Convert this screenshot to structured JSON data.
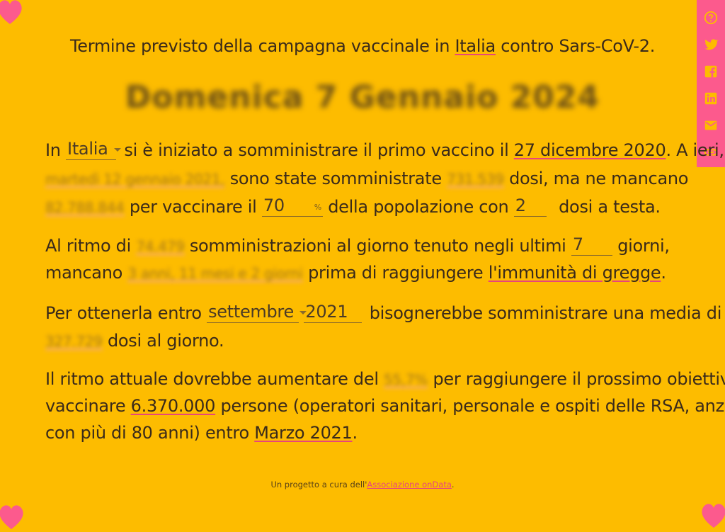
{
  "header": {
    "prefix": "Termine previsto della campagna vaccinale in",
    "country_link": "Italia",
    "suffix": "contro Sars-CoV-2.",
    "end_date": "Domenica 7 Gennaio 2024"
  },
  "para1": {
    "t1": "In",
    "country_select": "Italia",
    "t2": "si è iniziato a somministrare il primo vaccino il",
    "start_date": "27 dicembre 2020",
    "t3": ". A ieri,",
    "yesterday": "martedì 12 gennaio 2021,",
    "t4": "sono state somministrate",
    "doses_given": "731.539",
    "t5": "dosi, ma ne mancano",
    "doses_missing": "82.788.844",
    "t6": "per vaccinare il",
    "population_percent": "70",
    "percent_sign": "%",
    "t7": "della popolazione con",
    "doses_per_person": "2",
    "t8": "dosi a testa."
  },
  "para2": {
    "t1": "Al ritmo di",
    "rate": "74.479",
    "t2": "somministrazioni al giorno tenuto negli ultimi",
    "days": "7",
    "t3": "giorni,",
    "t4": "mancano",
    "remaining": "3 anni, 11 mesi e 2 giorni",
    "t5": "prima di raggiungere",
    "herd_link": "l'immunità di gregge",
    "t6": "."
  },
  "para3": {
    "t1": "Per ottenerla entro",
    "month_select": "settembre",
    "year": "2021",
    "t2": "bisognerebbe somministrare una media di",
    "daily_needed": "327.729",
    "t3": "dosi al giorno."
  },
  "para4": {
    "t1": "Il ritmo attuale dovrebbe aumentare del",
    "increase": "55,7%",
    "t2": "per raggiungere il prossimo obiettivo di",
    "t3": "vaccinare",
    "target_people": "6.370.000",
    "t4": "persone (operatori sanitari, personale e ospiti delle RSA, anziani",
    "t5": "con più di 80 anni) entro",
    "target_date": "Marzo 2021",
    "t6": "."
  },
  "footer": {
    "prefix": "Un progetto a cura dell'",
    "link": "Associazione onData",
    "suffix": "."
  },
  "sidebar": {
    "icons": [
      "help-icon",
      "twitter-icon",
      "facebook-icon",
      "linkedin-icon",
      "email-icon",
      "link-icon"
    ]
  },
  "colors": {
    "background": "#fdbc00",
    "accent": "#fc5a8d",
    "text": "#3a2a1a"
  }
}
